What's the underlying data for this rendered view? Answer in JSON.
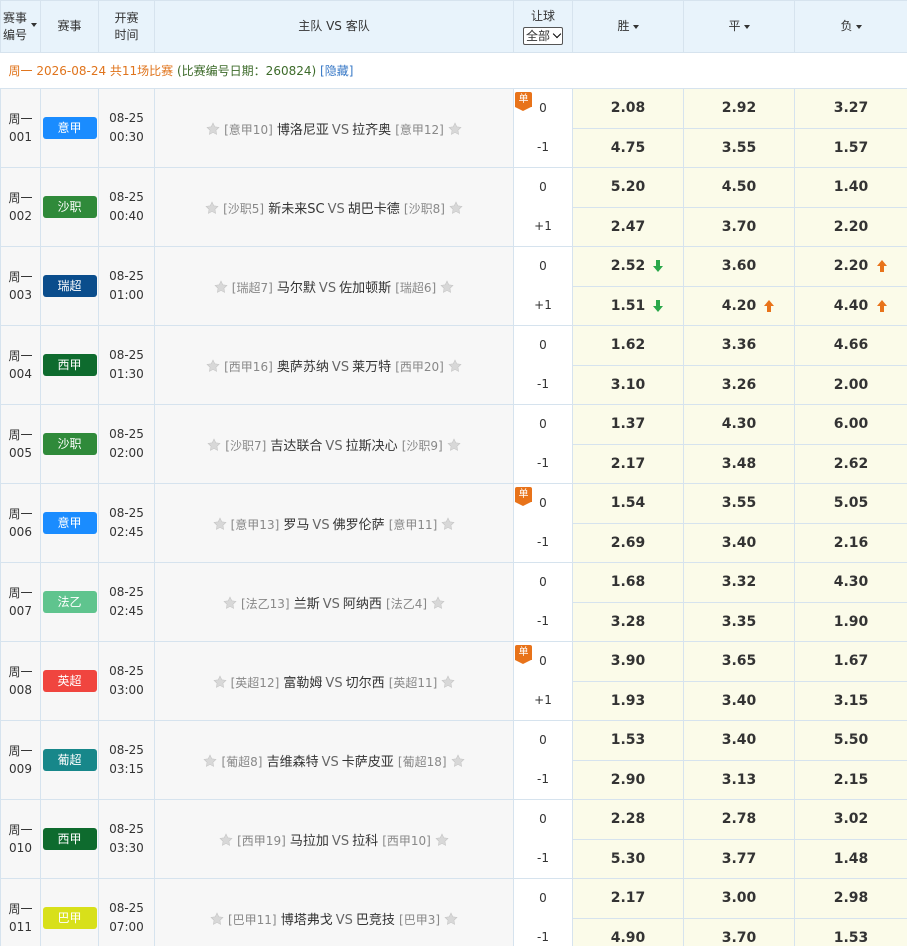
{
  "header": {
    "col_no": "赛事编号",
    "col_league": "赛事",
    "col_time": "开赛时间",
    "col_teams": "主队 VS 客队",
    "col_rq": "让球",
    "rq_select": "全部",
    "col_win": "胜",
    "col_draw": "平",
    "col_lose": "负"
  },
  "info": {
    "day": "周一",
    "date_count": "2026-08-24 共11场比赛",
    "code_date": "(比赛编号日期：260824)",
    "hide": "[隐藏]"
  },
  "colors": {
    "dan": "#e8731a",
    "up": "#e8731a",
    "down": "#2aa84a"
  },
  "matches": [
    {
      "day": "周一",
      "num": "001",
      "league": "意甲",
      "color": "#1a8cff",
      "date": "08-25",
      "time": "00:30",
      "home_rank": "[意甲10]",
      "home": "博洛尼亚",
      "vs": "VS",
      "away": "拉齐奥",
      "away_rank": "[意甲12]",
      "dan": "单",
      "rq": [
        "0",
        "-1"
      ],
      "odds": [
        [
          "2.08",
          "2.92",
          "3.27"
        ],
        [
          "4.75",
          "3.55",
          "1.57"
        ]
      ],
      "ind": [
        [
          "",
          "",
          ""
        ],
        [
          "",
          "",
          ""
        ]
      ]
    },
    {
      "day": "周一",
      "num": "002",
      "league": "沙职",
      "color": "#2f8a3a",
      "date": "08-25",
      "time": "00:40",
      "home_rank": "[沙职5]",
      "home": "新未来SC",
      "vs": "VS",
      "away": "胡巴卡德",
      "away_rank": "[沙职8]",
      "dan": "",
      "rq": [
        "0",
        "+1"
      ],
      "odds": [
        [
          "5.20",
          "4.50",
          "1.40"
        ],
        [
          "2.47",
          "3.70",
          "2.20"
        ]
      ],
      "ind": [
        [
          "",
          "",
          ""
        ],
        [
          "",
          "",
          ""
        ]
      ]
    },
    {
      "day": "周一",
      "num": "003",
      "league": "瑞超",
      "color": "#0a4d8c",
      "date": "08-25",
      "time": "01:00",
      "home_rank": "[瑞超7]",
      "home": "马尔默",
      "vs": "VS",
      "away": "佐加顿斯",
      "away_rank": "[瑞超6]",
      "dan": "",
      "rq": [
        "0",
        "+1"
      ],
      "odds": [
        [
          "2.52",
          "3.60",
          "2.20"
        ],
        [
          "1.51",
          "4.20",
          "4.40"
        ]
      ],
      "ind": [
        [
          "down",
          "",
          "up"
        ],
        [
          "down",
          "up",
          "up"
        ]
      ]
    },
    {
      "day": "周一",
      "num": "004",
      "league": "西甲",
      "color": "#0e6b2e",
      "date": "08-25",
      "time": "01:30",
      "home_rank": "[西甲16]",
      "home": "奥萨苏纳",
      "vs": "VS",
      "away": "莱万特",
      "away_rank": "[西甲20]",
      "dan": "",
      "rq": [
        "0",
        "-1"
      ],
      "odds": [
        [
          "1.62",
          "3.36",
          "4.66"
        ],
        [
          "3.10",
          "3.26",
          "2.00"
        ]
      ],
      "ind": [
        [
          "",
          "",
          ""
        ],
        [
          "",
          "",
          ""
        ]
      ]
    },
    {
      "day": "周一",
      "num": "005",
      "league": "沙职",
      "color": "#2f8a3a",
      "date": "08-25",
      "time": "02:00",
      "home_rank": "[沙职7]",
      "home": "吉达联合",
      "vs": "VS",
      "away": "拉斯决心",
      "away_rank": "[沙职9]",
      "dan": "",
      "rq": [
        "0",
        "-1"
      ],
      "odds": [
        [
          "1.37",
          "4.30",
          "6.00"
        ],
        [
          "2.17",
          "3.48",
          "2.62"
        ]
      ],
      "ind": [
        [
          "",
          "",
          ""
        ],
        [
          "",
          "",
          ""
        ]
      ]
    },
    {
      "day": "周一",
      "num": "006",
      "league": "意甲",
      "color": "#1a8cff",
      "date": "08-25",
      "time": "02:45",
      "home_rank": "[意甲13]",
      "home": "罗马",
      "vs": "VS",
      "away": "佛罗伦萨",
      "away_rank": "[意甲11]",
      "dan": "单",
      "rq": [
        "0",
        "-1"
      ],
      "odds": [
        [
          "1.54",
          "3.55",
          "5.05"
        ],
        [
          "2.69",
          "3.40",
          "2.16"
        ]
      ],
      "ind": [
        [
          "",
          "",
          ""
        ],
        [
          "",
          "",
          ""
        ]
      ]
    },
    {
      "day": "周一",
      "num": "007",
      "league": "法乙",
      "color": "#5fc48e",
      "date": "08-25",
      "time": "02:45",
      "home_rank": "[法乙13]",
      "home": "兰斯",
      "vs": "VS",
      "away": "阿纳西",
      "away_rank": "[法乙4]",
      "dan": "",
      "rq": [
        "0",
        "-1"
      ],
      "odds": [
        [
          "1.68",
          "3.32",
          "4.30"
        ],
        [
          "3.28",
          "3.35",
          "1.90"
        ]
      ],
      "ind": [
        [
          "",
          "",
          ""
        ],
        [
          "",
          "",
          ""
        ]
      ]
    },
    {
      "day": "周一",
      "num": "008",
      "league": "英超",
      "color": "#f0453f",
      "date": "08-25",
      "time": "03:00",
      "home_rank": "[英超12]",
      "home": "富勒姆",
      "vs": "VS",
      "away": "切尔西",
      "away_rank": "[英超11]",
      "dan": "单",
      "rq": [
        "0",
        "+1"
      ],
      "odds": [
        [
          "3.90",
          "3.65",
          "1.67"
        ],
        [
          "1.93",
          "3.40",
          "3.15"
        ]
      ],
      "ind": [
        [
          "",
          "",
          ""
        ],
        [
          "",
          "",
          ""
        ]
      ]
    },
    {
      "day": "周一",
      "num": "009",
      "league": "葡超",
      "color": "#17878a",
      "date": "08-25",
      "time": "03:15",
      "home_rank": "[葡超8]",
      "home": "吉维森特",
      "vs": "VS",
      "away": "卡萨皮亚",
      "away_rank": "[葡超18]",
      "dan": "",
      "rq": [
        "0",
        "-1"
      ],
      "odds": [
        [
          "1.53",
          "3.40",
          "5.50"
        ],
        [
          "2.90",
          "3.13",
          "2.15"
        ]
      ],
      "ind": [
        [
          "",
          "",
          ""
        ],
        [
          "",
          "",
          ""
        ]
      ]
    },
    {
      "day": "周一",
      "num": "010",
      "league": "西甲",
      "color": "#0e6b2e",
      "date": "08-25",
      "time": "03:30",
      "home_rank": "[西甲19]",
      "home": "马拉加",
      "vs": "VS",
      "away": "拉科",
      "away_rank": "[西甲10]",
      "dan": "",
      "rq": [
        "0",
        "-1"
      ],
      "odds": [
        [
          "2.28",
          "2.78",
          "3.02"
        ],
        [
          "5.30",
          "3.77",
          "1.48"
        ]
      ],
      "ind": [
        [
          "",
          "",
          ""
        ],
        [
          "",
          "",
          ""
        ]
      ]
    },
    {
      "day": "周一",
      "num": "011",
      "league": "巴甲",
      "color": "#d8e01a",
      "date": "08-25",
      "time": "07:00",
      "home_rank": "[巴甲11]",
      "home": "博塔弗戈",
      "vs": "VS",
      "away": "巴竞技",
      "away_rank": "[巴甲3]",
      "dan": "",
      "rq": [
        "0",
        "-1"
      ],
      "odds": [
        [
          "2.17",
          "3.00",
          "2.98"
        ],
        [
          "4.90",
          "3.70",
          "1.53"
        ]
      ],
      "ind": [
        [
          "",
          "",
          ""
        ],
        [
          "",
          "",
          ""
        ]
      ]
    }
  ]
}
